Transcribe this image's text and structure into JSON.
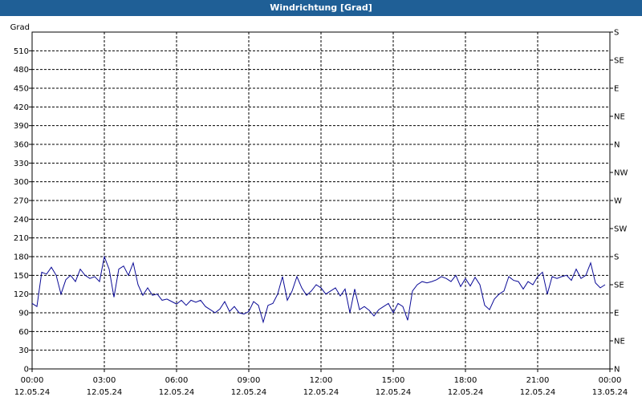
{
  "window": {
    "title": "Windrichtung [Grad]"
  },
  "chart_data": {
    "type": "line",
    "title": "Windrichtung [Grad]",
    "ylabel": "Grad",
    "ylim": [
      0,
      540
    ],
    "yticks": [
      0,
      30,
      60,
      90,
      120,
      150,
      180,
      210,
      240,
      270,
      300,
      330,
      360,
      390,
      420,
      450,
      480,
      510
    ],
    "xlim": [
      0,
      24
    ],
    "xticks": [
      {
        "t": 0,
        "time": "00:00",
        "date": "12.05.24"
      },
      {
        "t": 3,
        "time": "03:00",
        "date": "12.05.24"
      },
      {
        "t": 6,
        "time": "06:00",
        "date": "12.05.24"
      },
      {
        "t": 9,
        "time": "09:00",
        "date": "12.05.24"
      },
      {
        "t": 12,
        "time": "12:00",
        "date": "12.05.24"
      },
      {
        "t": 15,
        "time": "15:00",
        "date": "12.05.24"
      },
      {
        "t": 18,
        "time": "18:00",
        "date": "12.05.24"
      },
      {
        "t": 21,
        "time": "21:00",
        "date": "12.05.24"
      },
      {
        "t": 24,
        "time": "00:00",
        "date": "13.05.24"
      }
    ],
    "compass_axis": [
      {
        "deg": 0,
        "label": "N"
      },
      {
        "deg": 45,
        "label": "NE"
      },
      {
        "deg": 90,
        "label": "E"
      },
      {
        "deg": 135,
        "label": "SE"
      },
      {
        "deg": 180,
        "label": "S"
      },
      {
        "deg": 225,
        "label": "SW"
      },
      {
        "deg": 270,
        "label": "W"
      },
      {
        "deg": 315,
        "label": "NW"
      },
      {
        "deg": 360,
        "label": "N"
      },
      {
        "deg": 405,
        "label": "NE"
      },
      {
        "deg": 450,
        "label": "E"
      },
      {
        "deg": 495,
        "label": "SE"
      },
      {
        "deg": 540,
        "label": "S"
      }
    ],
    "grid": true,
    "line_color": "#0a0a96",
    "series": [
      {
        "x": [
          0.0,
          0.2,
          0.4,
          0.6,
          0.8,
          1.0,
          1.2,
          1.4,
          1.6,
          1.8,
          2.0,
          2.2,
          2.4,
          2.6,
          2.8,
          3.0,
          3.2,
          3.4,
          3.6,
          3.8,
          4.0,
          4.2,
          4.4,
          4.6,
          4.8,
          5.0,
          5.2,
          5.4,
          5.6,
          5.8,
          6.0,
          6.2,
          6.4,
          6.6,
          6.8,
          7.0,
          7.2,
          7.4,
          7.6,
          7.8,
          8.0,
          8.2,
          8.4,
          8.6,
          8.8,
          9.0,
          9.2,
          9.4,
          9.6,
          9.8,
          10.0,
          10.2,
          10.4,
          10.6,
          10.8,
          11.0,
          11.2,
          11.4,
          11.6,
          11.8,
          12.0,
          12.2,
          12.4,
          12.6,
          12.8,
          13.0,
          13.2,
          13.4,
          13.6,
          13.8,
          14.0,
          14.2,
          14.4,
          14.6,
          14.8,
          15.0,
          15.2,
          15.4,
          15.6,
          15.8,
          16.0,
          16.2,
          16.4,
          16.6,
          16.8,
          17.0,
          17.2,
          17.4,
          17.6,
          17.8,
          18.0,
          18.2,
          18.4,
          18.6,
          18.8,
          19.0,
          19.2,
          19.4,
          19.6,
          19.8,
          20.0,
          20.2,
          20.4,
          20.6,
          20.8,
          21.0,
          21.2,
          21.4,
          21.6,
          21.8,
          22.0,
          22.2,
          22.4,
          22.6,
          22.8,
          23.0,
          23.2,
          23.4,
          23.6,
          23.8
        ],
        "y": [
          105,
          100,
          155,
          152,
          163,
          150,
          120,
          143,
          150,
          140,
          160,
          150,
          145,
          148,
          140,
          180,
          160,
          115,
          160,
          165,
          150,
          170,
          135,
          118,
          130,
          118,
          120,
          110,
          112,
          108,
          104,
          110,
          102,
          110,
          107,
          110,
          100,
          95,
          90,
          96,
          108,
          92,
          100,
          90,
          88,
          92,
          108,
          102,
          75,
          102,
          105,
          120,
          148,
          110,
          125,
          148,
          130,
          118,
          125,
          135,
          130,
          120,
          125,
          130,
          117,
          128,
          90,
          128,
          95,
          100,
          94,
          85,
          95,
          100,
          105,
          90,
          105,
          100,
          78,
          125,
          135,
          140,
          138,
          140,
          143,
          148,
          145,
          140,
          150,
          132,
          145,
          133,
          147,
          135,
          102,
          95,
          112,
          120,
          125,
          148,
          142,
          140,
          128,
          140,
          135,
          148,
          155,
          120,
          148,
          145,
          148,
          150,
          142,
          160,
          145,
          150,
          170,
          138,
          130,
          135
        ]
      }
    ]
  }
}
